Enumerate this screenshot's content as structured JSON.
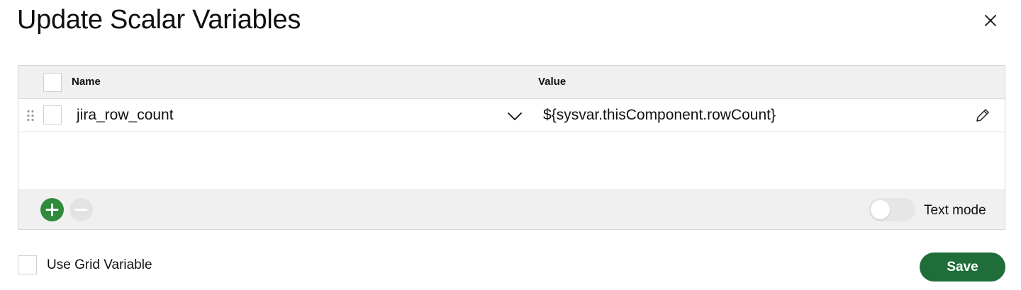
{
  "dialog": {
    "title": "Update Scalar Variables"
  },
  "table": {
    "columns": [
      "Name",
      "Value"
    ],
    "rows": [
      {
        "name": "jira_row_count",
        "value": "${sysvar.thisComponent.rowCount}"
      }
    ]
  },
  "footer": {
    "text_mode_label": "Text mode",
    "text_mode_enabled": false
  },
  "options": {
    "use_grid_variable_label": "Use Grid Variable",
    "use_grid_variable_checked": false
  },
  "actions": {
    "save_label": "Save"
  },
  "colors": {
    "add_button": "#2f8a3b",
    "save_button": "#1f6e3a",
    "header_bg": "#f0f0f0"
  },
  "icons": [
    "close-icon",
    "drag-handle-icon",
    "chevron-down-icon",
    "pencil-icon",
    "plus-icon",
    "minus-icon"
  ]
}
